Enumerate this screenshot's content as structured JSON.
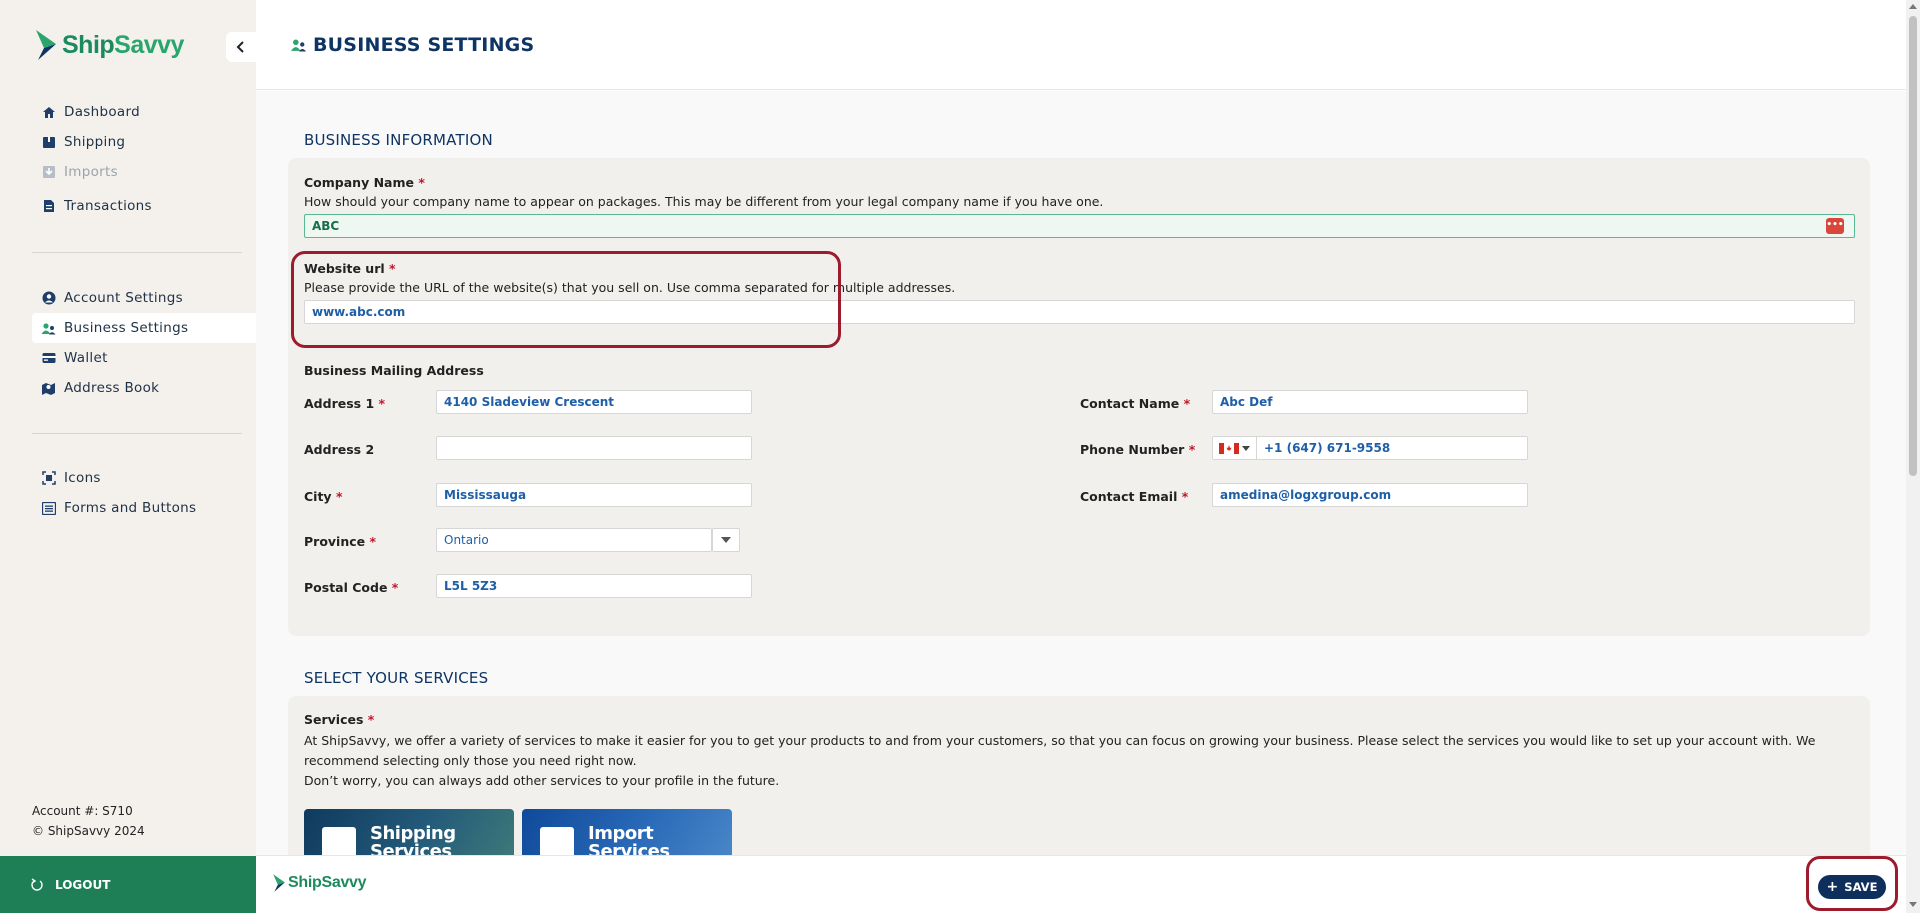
{
  "brand": {
    "name_a": "Ship",
    "name_b": "Savvy"
  },
  "sidebar": {
    "collapse_icon": "chevron-left-icon",
    "group1": [
      {
        "label": "Dashboard",
        "icon": "home-icon"
      },
      {
        "label": "Shipping",
        "icon": "box-icon"
      },
      {
        "label": "Imports",
        "icon": "import-icon",
        "disabled": true
      },
      {
        "label": "Transactions",
        "icon": "document-icon"
      }
    ],
    "group2": [
      {
        "label": "Account Settings",
        "icon": "user-icon"
      },
      {
        "label": "Business Settings",
        "icon": "business-users-icon",
        "active": true
      },
      {
        "label": "Wallet",
        "icon": "wallet-icon"
      },
      {
        "label": "Address Book",
        "icon": "address-book-icon"
      }
    ],
    "group3": [
      {
        "label": "Icons",
        "icon": "icons-icon"
      },
      {
        "label": "Forms and Buttons",
        "icon": "list-icon"
      }
    ],
    "account_number": "Account #: S710",
    "copyright": "© ShipSavvy 2024",
    "logout_label": "LOGOUT"
  },
  "header": {
    "title": "BUSINESS SETTINGS"
  },
  "business_info": {
    "section_title": "BUSINESS INFORMATION",
    "company_name": {
      "label": "Company Name",
      "required": "*",
      "hint": "How should your company name to appear on packages. This may be different from your legal company name if you have one.",
      "value": "ABC",
      "badge": "•••"
    },
    "website": {
      "label": "Website url",
      "required": "*",
      "hint": "Please provide the URL of the website(s) that you sell on. Use comma separated for multiple addresses.",
      "value": "www.abc.com"
    },
    "mailing_title": "Business Mailing Address",
    "address1": {
      "label": "Address 1",
      "required": "*",
      "value": "4140 Sladeview Crescent"
    },
    "address2": {
      "label": "Address 2",
      "value": ""
    },
    "city": {
      "label": "City",
      "required": "*",
      "value": "Mississauga"
    },
    "province": {
      "label": "Province",
      "required": "*",
      "value": "Ontario"
    },
    "postal": {
      "label": "Postal Code",
      "required": "*",
      "value": "L5L 5Z3"
    },
    "contact_name": {
      "label": "Contact Name",
      "required": "*",
      "value": "Abc Def"
    },
    "phone": {
      "label": "Phone Number",
      "required": "*",
      "value": "+1 (647) 671-9558",
      "country": "CA"
    },
    "contact_email": {
      "label": "Contact Email",
      "required": "*",
      "value": "amedina@logxgroup.com"
    }
  },
  "services": {
    "section_title": "SELECT YOUR SERVICES",
    "label": "Services",
    "required": "*",
    "desc1": "At ShipSavvy, we offer a variety of services to make it easier for you to get your products to and from your customers, so that you can focus on growing your business. Please select the services you would like to set up your account with. We",
    "desc2": "recommend selecting only those you need right now.",
    "desc3": "Don’t worry, you can always add other services to your profile in the future.",
    "tiles": [
      {
        "label_a": "Shipping",
        "label_b": "Services"
      },
      {
        "label_a": "Import",
        "label_b": "Services"
      }
    ]
  },
  "footer": {
    "save_label": "SAVE"
  },
  "colors": {
    "brand_green": "#1e7e55",
    "navy": "#0e2f5c",
    "highlight": "#9c1b2c"
  }
}
